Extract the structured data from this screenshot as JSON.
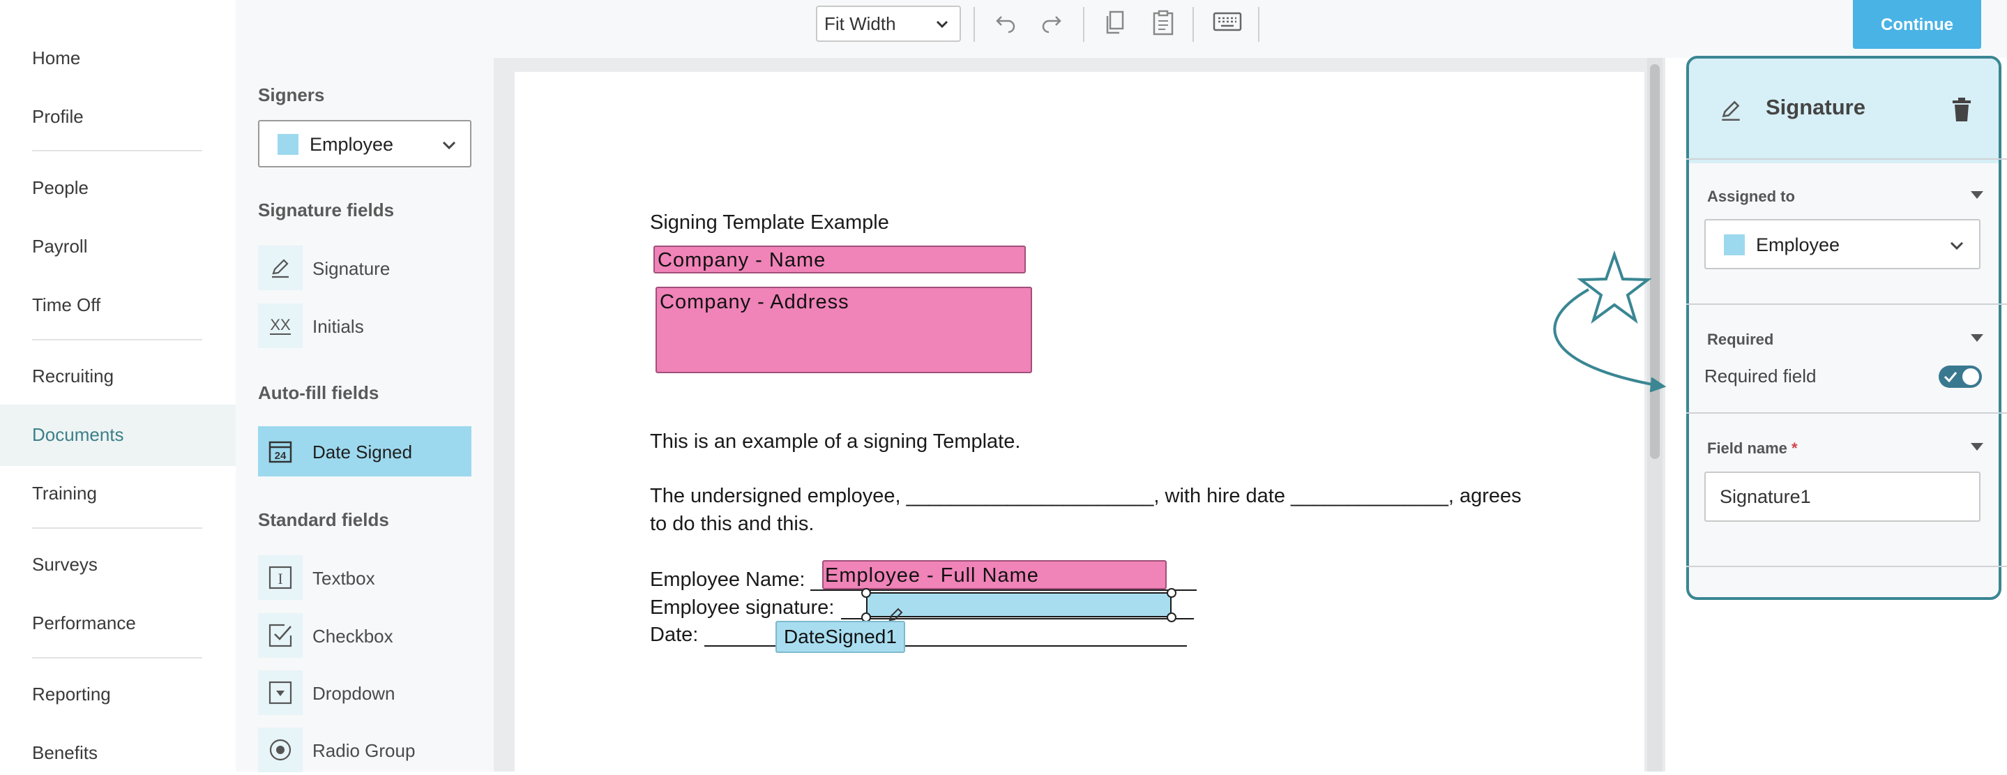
{
  "nav": {
    "items": [
      "Home",
      "Profile",
      "People",
      "Payroll",
      "Time Off",
      "Recruiting",
      "Documents",
      "Training",
      "Surveys",
      "Performance",
      "Reporting",
      "Benefits"
    ],
    "active": "Documents"
  },
  "toolbar": {
    "zoom_value": "Fit Width",
    "continue_label": "Continue"
  },
  "fields_panel": {
    "signers_heading": "Signers",
    "signer_selected": "Employee",
    "signature_heading": "Signature fields",
    "signature_items": [
      "Signature",
      "Initials"
    ],
    "initials_glyph": "XX",
    "autofill_heading": "Auto-fill fields",
    "autofill_items": [
      "Date Signed"
    ],
    "calendar_glyph": "24",
    "standard_heading": "Standard fields",
    "standard_items": [
      "Textbox",
      "Checkbox",
      "Dropdown",
      "Radio Group"
    ],
    "textbox_glyph": "I"
  },
  "document": {
    "title": "Signing Template Example",
    "company_name_field": "Company - Name",
    "company_address_field": "Company - Address",
    "intro": "This is an example of a signing Template.",
    "para_line1": "The undersigned employee, ______________________, with hire date ______________, agrees",
    "para_line2": "to do this and this.",
    "employee_name_label": "Employee Name:",
    "employee_name_field": "Employee - Full Name",
    "employee_signature_label": "Employee signature:",
    "date_label": "Date:",
    "date_field": "DateSigned1"
  },
  "properties": {
    "title": "Signature",
    "assigned_heading": "Assigned to",
    "assigned_value": "Employee",
    "required_heading": "Required",
    "required_label": "Required field",
    "required_on": true,
    "field_name_heading": "Field name",
    "field_name_required_mark": "*",
    "field_name_value": "Signature1"
  },
  "colors": {
    "accent_teal": "#3a8693",
    "signer_blue": "#9dd9ee",
    "company_pink": "#f083b8",
    "continue_blue": "#4ab3e6"
  }
}
